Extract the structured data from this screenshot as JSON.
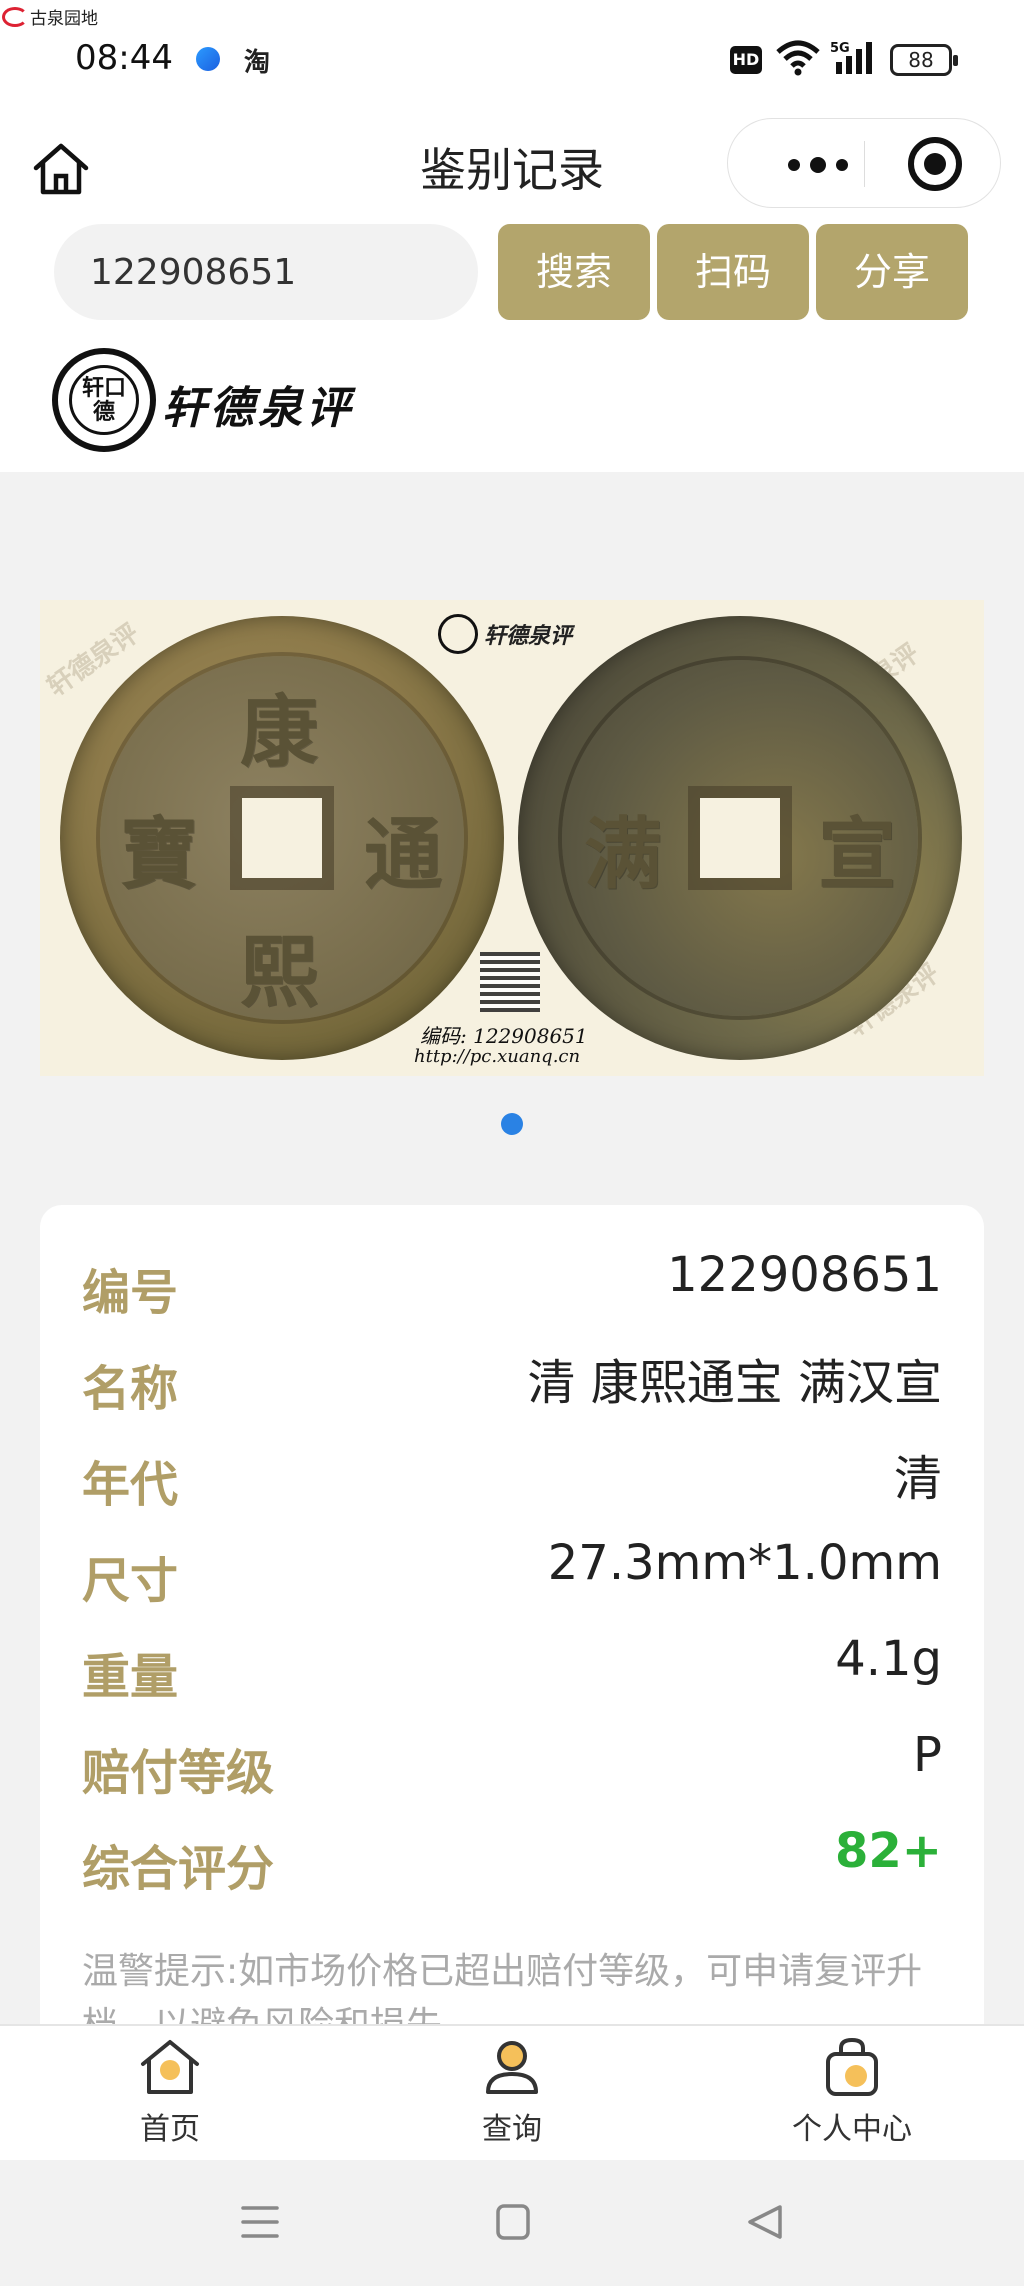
{
  "status_bar": {
    "watermark": "古泉园地",
    "time": "08:44",
    "app_badge": "淘",
    "hd": "HD",
    "network": "5G",
    "battery": "88"
  },
  "title_bar": {
    "title": "鉴别记录"
  },
  "search": {
    "value": "122908651",
    "buttons": {
      "search": "搜索",
      "scan": "扫码",
      "share": "分享"
    }
  },
  "brand": {
    "seal_text": "轩口德",
    "name": "轩德泉评"
  },
  "coin_image": {
    "obverse_chars": [
      "康",
      "熙",
      "通",
      "寶"
    ],
    "reverse_chars": [
      "宣",
      "满"
    ],
    "brand": "轩德泉评",
    "code": "编码: 122908651",
    "url": "http://pc.xuanq.cn"
  },
  "details": {
    "rows": [
      {
        "label": "编号",
        "value": "122908651"
      },
      {
        "label": "名称",
        "value": "清 康熙通宝 满汉宣"
      },
      {
        "label": "年代",
        "value": "清"
      },
      {
        "label": "尺寸",
        "value": "27.3mm*1.0mm"
      },
      {
        "label": "重量",
        "value": "4.1g"
      },
      {
        "label": "赔付等级",
        "value": "P"
      },
      {
        "label": "综合评分",
        "value": "82+"
      }
    ],
    "notice": "温警提示:如市场价格已超出赔付等级，可申请复评升档，以避免风险和损失。",
    "score_color": "#2bb039",
    "label_color": "#b09e67"
  },
  "tabbar": {
    "home": "首页",
    "query": "查询",
    "profile": "个人中心"
  },
  "colors": {
    "accent": "#b3a56c",
    "tab_icon_fill": "#f5c05a",
    "pager_dot": "#2a82e4"
  }
}
